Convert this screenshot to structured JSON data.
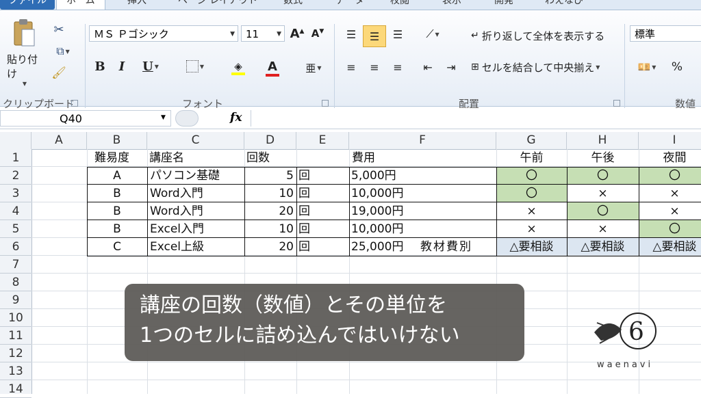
{
  "tabs": [
    {
      "label": "ファイル"
    },
    {
      "label": "ホーム"
    },
    {
      "label": "挿入"
    },
    {
      "label": "ページ レイアウト"
    },
    {
      "label": "数式"
    },
    {
      "label": "データ"
    },
    {
      "label": "校閲"
    },
    {
      "label": "表示"
    },
    {
      "label": "開発"
    },
    {
      "label": "わえなび"
    }
  ],
  "ribbon": {
    "clipboard": {
      "paste_label": "貼り付け",
      "group_label": "クリップボード"
    },
    "font": {
      "font_name": "ＭＳ Ｐゴシック",
      "font_size": "11",
      "group_label": "フォント"
    },
    "alignment": {
      "wrap_label": "折り返して全体を表示する",
      "merge_label": "セルを結合して中央揃え",
      "group_label": "配置"
    },
    "number": {
      "format": "標準",
      "percent": "%",
      "group_label": "数値"
    }
  },
  "formula_bar": {
    "name_box": "Q40",
    "fx": "fx",
    "value": ""
  },
  "columns": [
    "A",
    "B",
    "C",
    "D",
    "E",
    "F",
    "G",
    "H",
    "I"
  ],
  "rows": [
    "1",
    "2",
    "3",
    "4",
    "5",
    "6",
    "7",
    "8",
    "9",
    "10",
    "11",
    "12",
    "13",
    "14"
  ],
  "table": {
    "headers": {
      "difficulty": "難易度",
      "course": "講座名",
      "count": "回数",
      "fee": "費用",
      "morning": "午前",
      "afternoon": "午後",
      "night": "夜間"
    },
    "rows": [
      {
        "difficulty": "A",
        "course": "パソコン基礎",
        "count": "5",
        "unit": "回",
        "fee": "5,000円",
        "note": "",
        "morning": "〇",
        "afternoon": "〇",
        "night": "〇"
      },
      {
        "difficulty": "B",
        "course": "Word入門",
        "count": "10",
        "unit": "回",
        "fee": "10,000円",
        "note": "",
        "morning": "〇",
        "afternoon": "×",
        "night": "×"
      },
      {
        "difficulty": "B",
        "course": "Word入門",
        "count": "20",
        "unit": "回",
        "fee": "19,000円",
        "note": "",
        "morning": "×",
        "afternoon": "〇",
        "night": "×"
      },
      {
        "difficulty": "B",
        "course": "Excel入門",
        "count": "10",
        "unit": "回",
        "fee": "10,000円",
        "note": "",
        "morning": "×",
        "afternoon": "×",
        "night": "〇"
      },
      {
        "difficulty": "C",
        "course": "Excel上級",
        "count": "20",
        "unit": "回",
        "fee": "25,000円",
        "note": "教材費別",
        "morning": "△要相談",
        "afternoon": "△要相談",
        "night": "△要相談"
      }
    ]
  },
  "subtitle": {
    "line1": "講座の回数（数値）とその単位を",
    "line2": "1つのセルに詰め込んではいけない"
  },
  "logo": {
    "text": "waenavi"
  },
  "colors": {
    "green_fill": "#c6dfb4",
    "blue_fill": "#dce6f1",
    "file_tab": "#2f6db5",
    "subtitle_bg": "#5a5855"
  }
}
